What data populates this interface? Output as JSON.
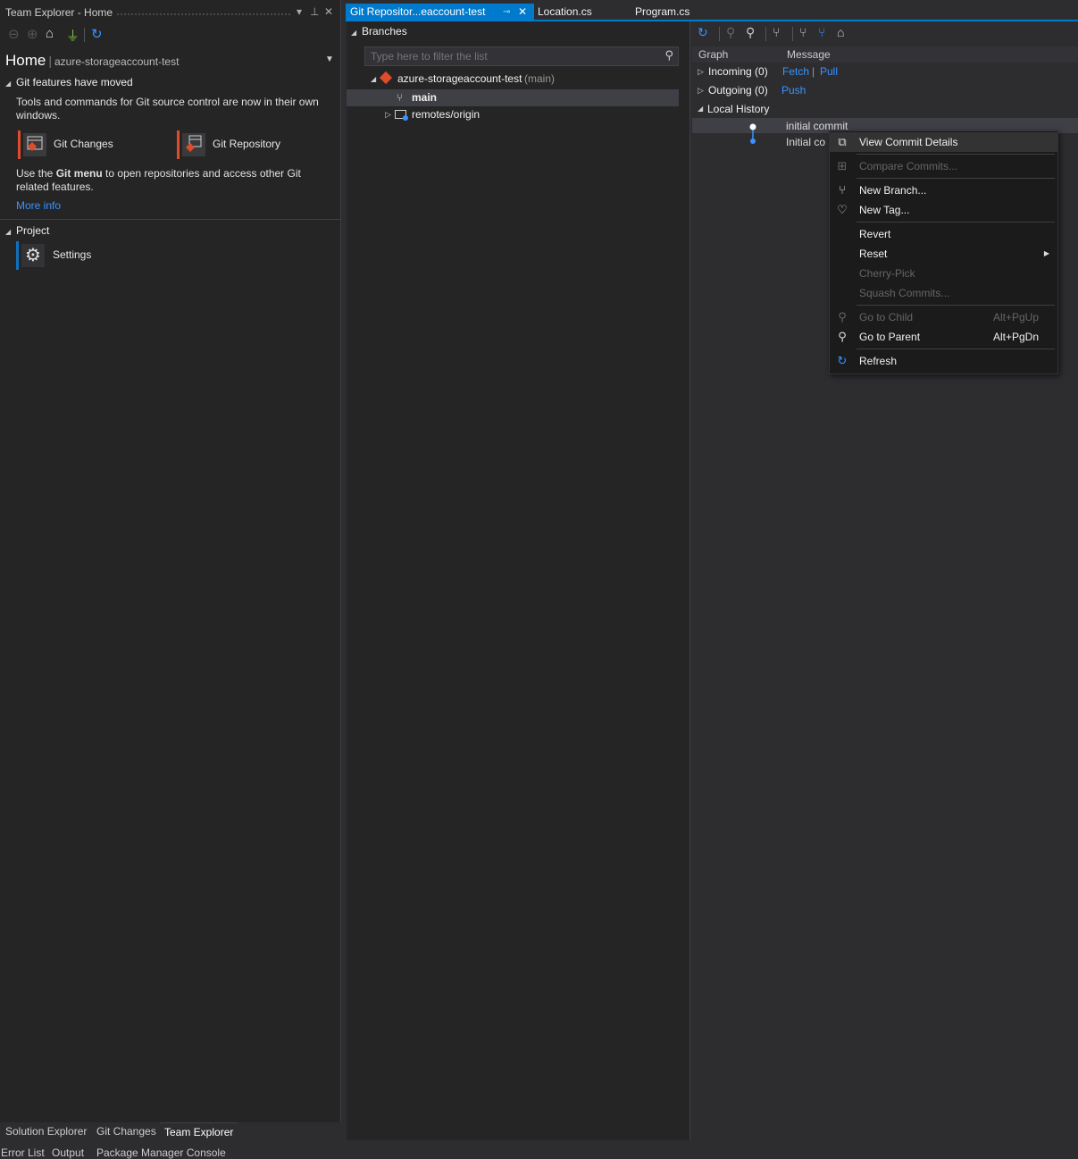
{
  "team_explorer": {
    "title": "Team Explorer - Home",
    "home_label": "Home",
    "repo_name": "azure-storageaccount-test",
    "git_moved": {
      "heading": "Git features have moved",
      "body": "Tools and commands for Git source control are now in their own windows.",
      "git_changes": "Git Changes",
      "git_repository": "Git Repository",
      "menu_prefix": "Use the ",
      "menu_bold": "Git menu",
      "menu_suffix": " to open repositories and access other Git related features.",
      "more_info": "More info"
    },
    "project": {
      "heading": "Project",
      "settings": "Settings"
    }
  },
  "bottom_tabs": [
    "Solution Explorer",
    "Git Changes",
    "Team Explorer"
  ],
  "status_tabs": [
    "Error List",
    "Output",
    "Package Manager Console"
  ],
  "doc_tabs": {
    "active": "Git Repositor...eaccount-test",
    "tab2": "Location.cs",
    "tab3": "Program.cs"
  },
  "branches": {
    "heading": "Branches",
    "filter_placeholder": "Type here to filter the list",
    "repo": "azure-storageaccount-test",
    "repo_branch": "(main)",
    "main": "main",
    "remotes": "remotes/origin"
  },
  "history": {
    "col_graph": "Graph",
    "col_message": "Message",
    "incoming": "Incoming (0)",
    "fetch": "Fetch",
    "pull": "Pull",
    "outgoing": "Outgoing (0)",
    "push": "Push",
    "local_history": "Local History",
    "commit1": "initial commit",
    "commit2": "Initial co"
  },
  "context_menu": {
    "view_commit_details": "View Commit Details",
    "compare_commits": "Compare Commits...",
    "new_branch": "New Branch...",
    "new_tag": "New Tag...",
    "revert": "Revert",
    "reset": "Reset",
    "cherry_pick": "Cherry-Pick",
    "squash_commits": "Squash Commits...",
    "go_to_child": "Go to Child",
    "go_to_child_shortcut": "Alt+PgUp",
    "go_to_parent": "Go to Parent",
    "go_to_parent_shortcut": "Alt+PgDn",
    "refresh": "Refresh"
  },
  "colors": {
    "accent": "#007acc",
    "git_red": "#e04c2b",
    "link": "#3794ff"
  }
}
